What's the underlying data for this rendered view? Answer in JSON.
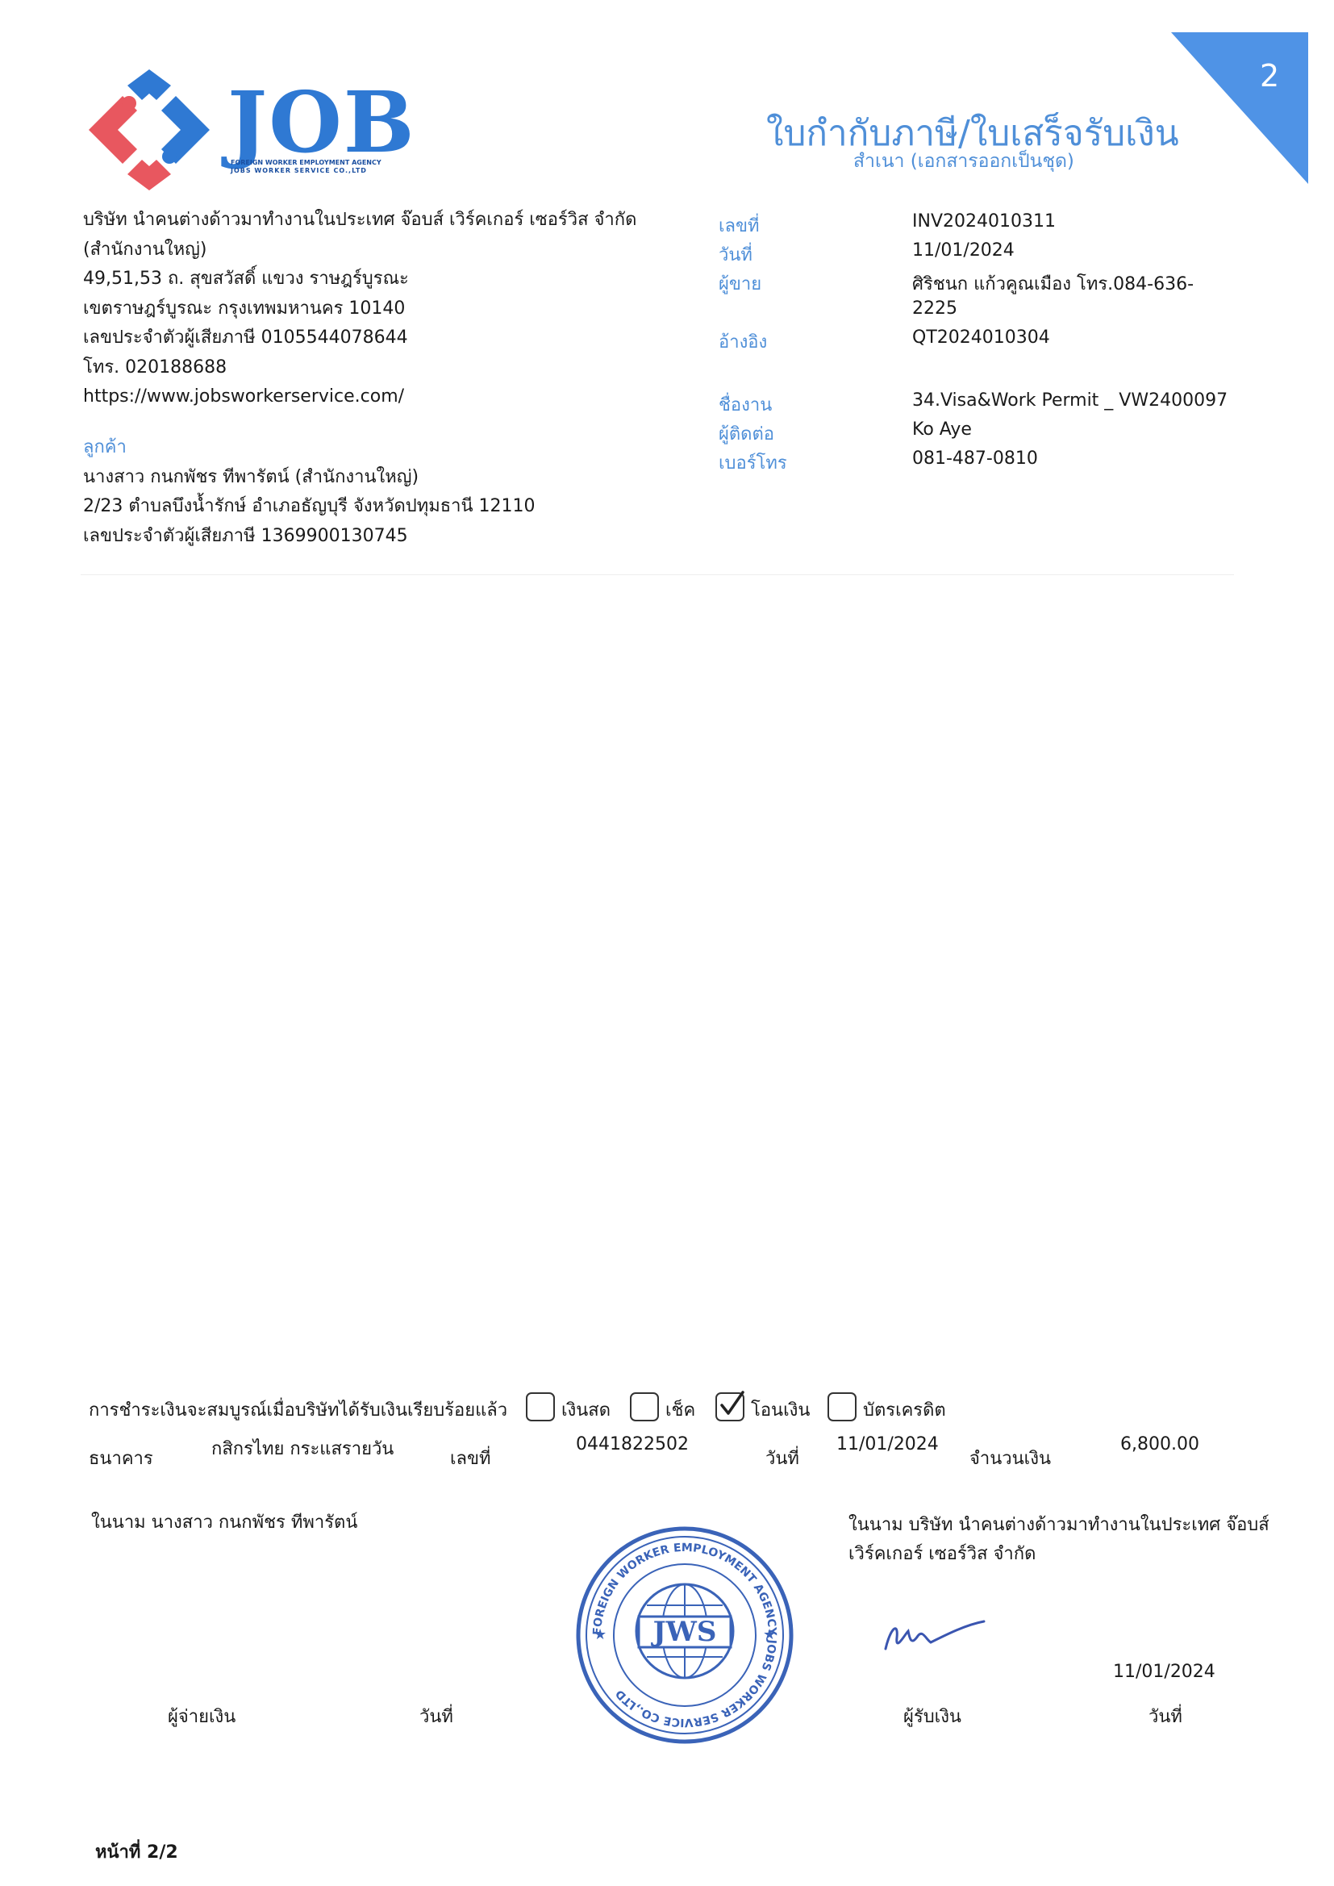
{
  "page_badge": "2",
  "logo": {
    "brand": "JOB",
    "tagline_1": "FOREIGN WORKER EMPLOYMENT AGENCY",
    "tagline_2": "JOBS WORKER SERVICE CO.,LTD"
  },
  "document": {
    "title": "ใบกำกับภาษี/ใบเสร็จรับเงิน",
    "subtitle": "สำเนา (เอกสารออกเป็นชุด)"
  },
  "company": {
    "lines": [
      "บริษัท นำคนต่างด้าวมาทำงานในประเทศ จ๊อบส์ เวิร์คเกอร์ เซอร์วิส จำกัด",
      "(สำนักงานใหญ่)",
      "49,51,53 ถ. สุขสวัสดิ์ แขวง ราษฎร์บูรณะ",
      "เขตราษฎร์บูรณะ กรุงเทพมหานคร 10140",
      "เลขประจำตัวผู้เสียภาษี 0105544078644",
      "โทร. 020188688",
      "https://www.jobsworkerservice.com/"
    ]
  },
  "customer": {
    "label": "ลูกค้า",
    "lines": [
      "นางสาว กนกพัชร ทีพารัตน์ (สำนักงานใหญ่)",
      "2/23 ตำบลบึงน้ำรักษ์ อำเภอธัญบุรี จังหวัดปทุมธานี 12110",
      "เลขประจำตัวผู้เสียภาษี 1369900130745"
    ]
  },
  "meta": {
    "number_label": "เลขที่",
    "number": "INV2024010311",
    "date_label": "วันที่",
    "date": "11/01/2024",
    "seller_label": "ผู้ขาย",
    "seller_1": "ศิริชนก แก้วคูณเมือง โทร.084-636-",
    "seller_2": "2225",
    "ref_label": "อ้างอิง",
    "ref": "QT2024010304",
    "job_label": "ชื่องาน",
    "job": "34.Visa&Work Permit _ VW2400097",
    "contact_label": "ผู้ติดต่อ",
    "contact": "Ko Aye",
    "phone_label": "เบอร์โทร",
    "phone": "081-487-0810"
  },
  "payment": {
    "statement": "การชำระเงินจะสมบูรณ์เมื่อบริษัทได้รับเงินเรียบร้อยแล้ว",
    "methods": [
      {
        "label": "เงินสด",
        "checked": false
      },
      {
        "label": "เช็ค",
        "checked": false
      },
      {
        "label": "โอนเงิน",
        "checked": true
      },
      {
        "label": "บัตรเครดิต",
        "checked": false
      }
    ],
    "bank_label": "ธนาคาร",
    "bank": "กสิกรไทย กระแสรายวัน",
    "no_label": "เลขที่",
    "no": "0441822502",
    "date_label": "วันที่",
    "date": "11/01/2024",
    "amount_label": "จำนวนเงิน",
    "amount": "6,800.00"
  },
  "signatures": {
    "payer_onbehalf": "ในนาม นางสาว กนกพัชร ทีพารัตน์",
    "receiver_onbehalf_1": "ในนาม บริษัท นำคนต่างด้าวมาทำงานในประเทศ จ๊อบส์",
    "receiver_onbehalf_2": "เวิร์คเกอร์ เซอร์วิส จำกัด",
    "payer_label": "ผู้จ่ายเงิน",
    "payer_date_label": "วันที่",
    "receiver_label": "ผู้รับเงิน",
    "receiver_date_label": "วันที่",
    "receiver_date": "11/01/2024"
  },
  "stamp": {
    "center_text": "JWS",
    "ring_text": "FOREIGN WORKER EMPLOYMENT AGENCY JOBS WORKER SERVICE CO.,LTD"
  },
  "footer": {
    "page": "หน้าที่ 2/2"
  },
  "colors": {
    "accent": "#4f8fd8",
    "logo_blue": "#2f79d3",
    "logo_red": "#e8575f",
    "stamp_blue": "#3a63b8"
  }
}
